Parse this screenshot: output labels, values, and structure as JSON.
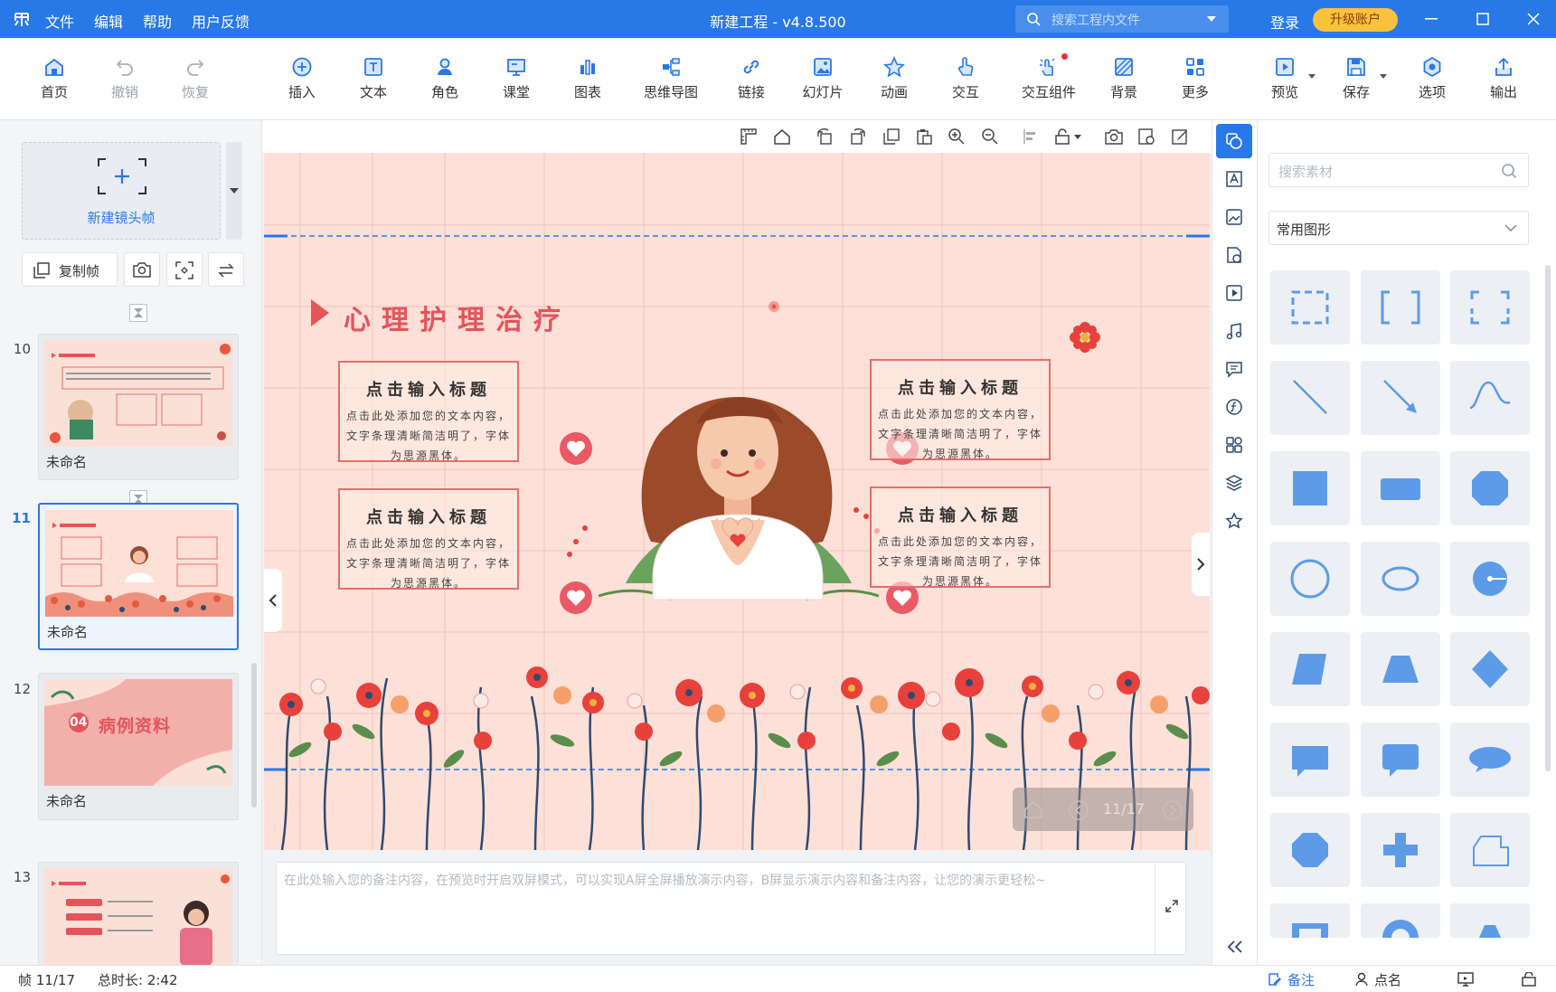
{
  "window": {
    "menu": [
      "文件",
      "编辑",
      "帮助",
      "用户反馈"
    ],
    "title": "新建工程 - v4.8.500",
    "search_placeholder": "搜索工程内文件",
    "login": "登录",
    "upgrade": "升级账户",
    "logo_icon": "app-logo-icon"
  },
  "toolbar": {
    "home": "首页",
    "undo": "撤销",
    "redo": "恢复",
    "insert": "插入",
    "text": "文本",
    "role": "角色",
    "lesson": "课堂",
    "chart": "图表",
    "mindmap": "思维导图",
    "link": "链接",
    "slideshow": "幻灯片",
    "animation": "动画",
    "interact": "交互",
    "widget": "交互组件",
    "background": "背景",
    "more": "更多",
    "preview": "预览",
    "save": "保存",
    "options": "选项",
    "export": "输出"
  },
  "left_panel": {
    "new_frame": "新建镜头帧",
    "copy_frame": "复制帧",
    "frames": [
      {
        "num": "10",
        "name": "未命名",
        "selected": false
      },
      {
        "num": "11",
        "name": "未命名",
        "selected": true
      },
      {
        "num": "12",
        "name": "未命名",
        "selected": false
      },
      {
        "num": "13",
        "name": "",
        "selected": false
      }
    ],
    "thumb12_text": "病例资料",
    "thumb12_num": "04"
  },
  "slide": {
    "title": "心理护理治疗",
    "boxes": [
      {
        "heading": "点击输入标题",
        "line1": "点击此处添加您的文本内容，",
        "line2": "文字条理清晰简洁明了，字体",
        "line3": "为思源黑体。"
      },
      {
        "heading": "点击输入标题",
        "line1": "点击此处添加您的文本内容，",
        "line2": "文字条理清晰简洁明了，字体",
        "line3": "为思源黑体。"
      },
      {
        "heading": "点击输入标题",
        "line1": "点击此处添加您的文本内容，",
        "line2": "文字条理清晰简洁明了，字体",
        "line3": "为思源黑体。"
      },
      {
        "heading": "点击输入标题",
        "line1": "点击此处添加您的文本内容，",
        "line2": "文字条理清晰简洁明了，字体",
        "line3": "为思源黑体。"
      }
    ],
    "page_indicator": "11/17",
    "accent": "#e5545a"
  },
  "notes_placeholder": "在此处输入您的备注内容，在预览时开启双屏模式，可以实现A屏全屏播放演示内容，B屏显示演示内容和备注内容，让您的演示更轻松~",
  "materials": {
    "search_placeholder": "搜索素材",
    "category": "常用图形"
  },
  "status": {
    "frame": "帧 11/17",
    "duration": "总时长: 2:42",
    "notes": "备注",
    "rollcall": "点名"
  },
  "colors": {
    "primary": "#2878e7",
    "shape": "#5d9be9",
    "upgrade": "#f9c23c"
  }
}
